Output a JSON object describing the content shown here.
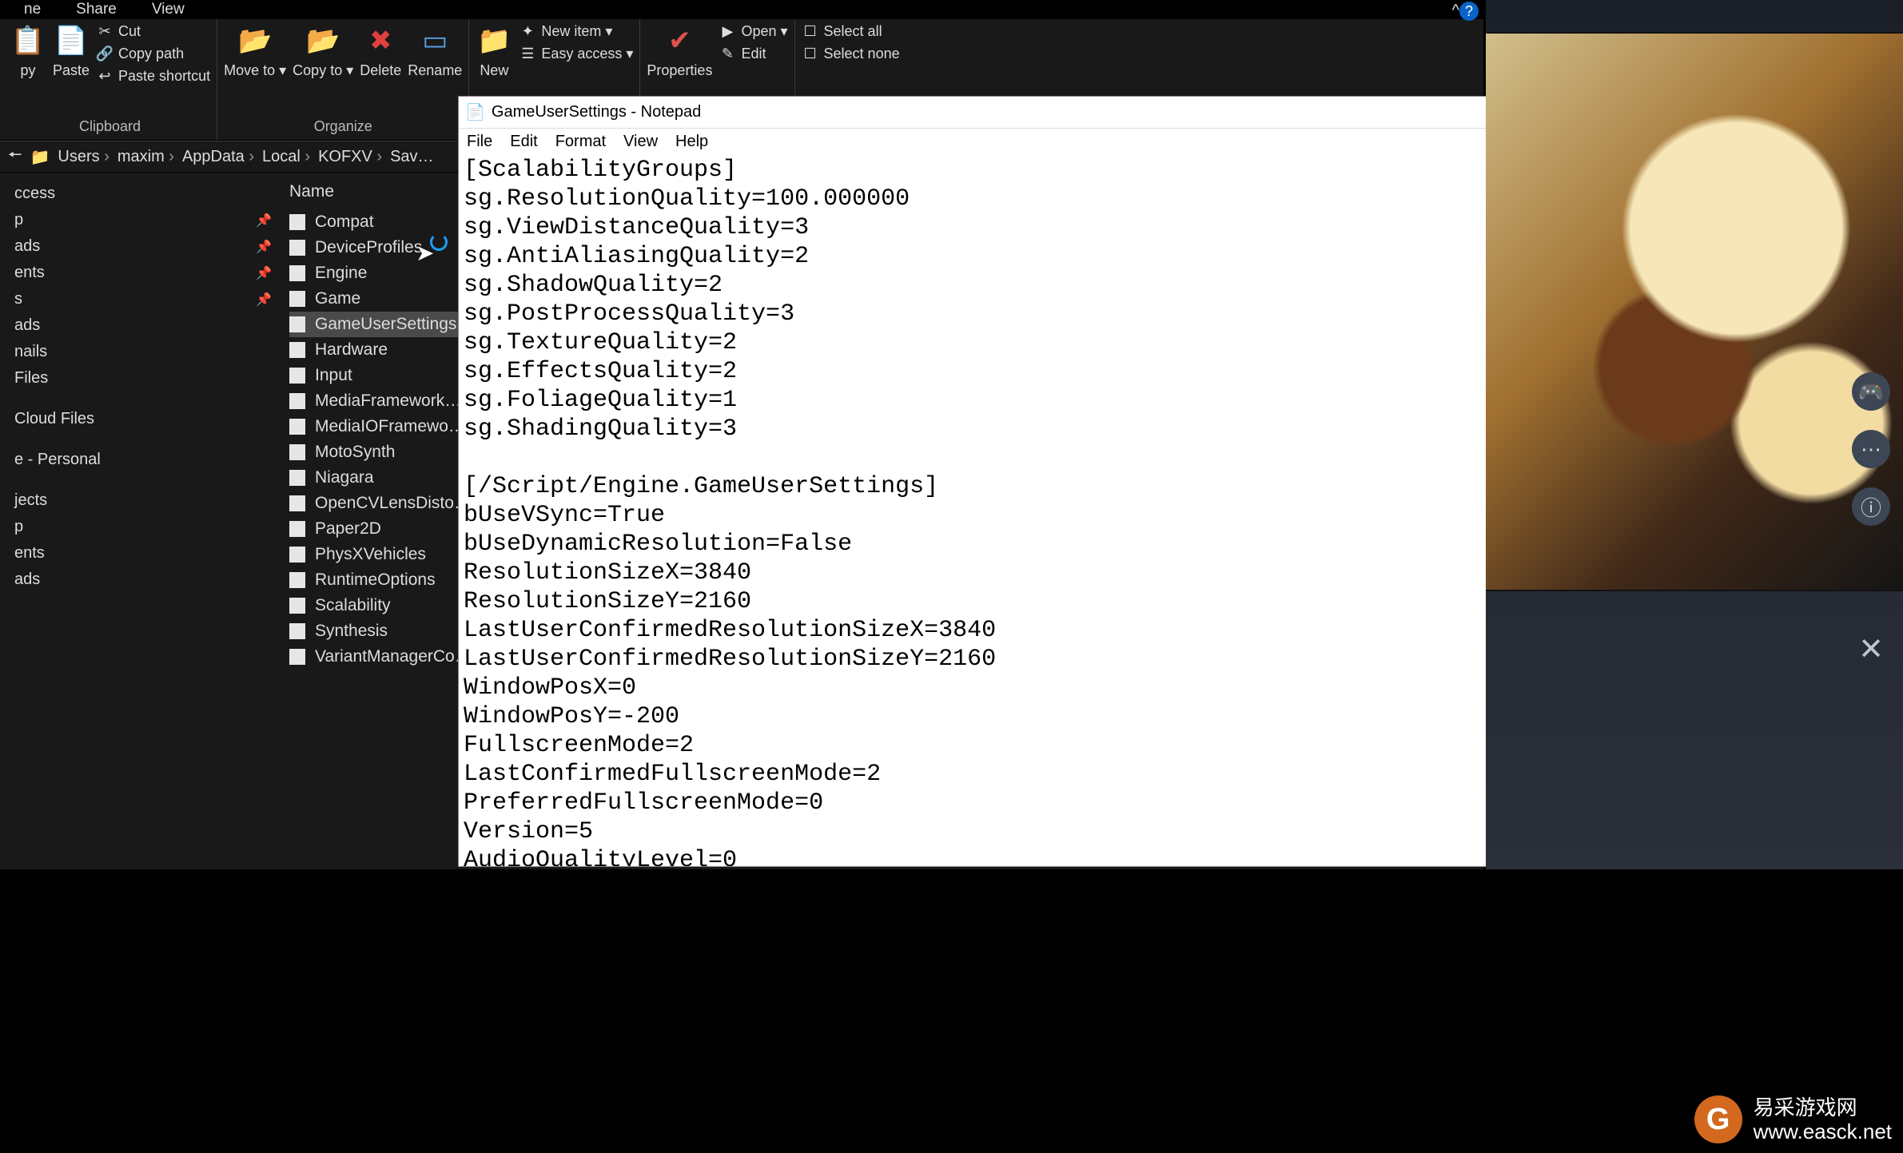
{
  "explorer": {
    "tabs": [
      "ne",
      "Share",
      "View"
    ],
    "ribbon_collapse_tip": "^",
    "ribbon": {
      "clipboard": {
        "label": "Clipboard",
        "paste": "Paste",
        "cut": "Cut",
        "copypath": "Copy path",
        "pasteshortcut": "Paste shortcut",
        "copy": "py"
      },
      "organize": {
        "label": "Organize",
        "moveto": "Move to ▾",
        "copyto": "Copy to ▾",
        "delete": "Delete",
        "rename": "Rename"
      },
      "new": {
        "label": "",
        "new": "New",
        "newitem": "New item ▾",
        "easyaccess": "Easy access ▾"
      },
      "open": {
        "label": "",
        "properties": "Properties",
        "open": "Open ▾",
        "edit": "Edit"
      },
      "select": {
        "label": "",
        "selectall": "Select all",
        "selectnone": "Select none"
      }
    },
    "breadcrumbs": [
      "Users",
      "maxim",
      "AppData",
      "Local",
      "KOFXV",
      "Sav…"
    ],
    "nav": [
      {
        "label": "ccess",
        "pin": false
      },
      {
        "label": "p",
        "pin": true
      },
      {
        "label": "ads",
        "pin": true
      },
      {
        "label": "ents",
        "pin": true
      },
      {
        "label": "s",
        "pin": true
      },
      {
        "label": "ads",
        "pin": false
      },
      {
        "label": "nails",
        "pin": false
      },
      {
        "label": "Files",
        "pin": false
      },
      {
        "sep": true
      },
      {
        "label": "Cloud Files",
        "pin": false
      },
      {
        "sep": true
      },
      {
        "label": "e - Personal",
        "pin": false
      },
      {
        "sep": true
      },
      {
        "label": "jects",
        "pin": false
      },
      {
        "label": "p",
        "pin": false
      },
      {
        "label": "ents",
        "pin": false
      },
      {
        "label": "ads",
        "pin": false
      }
    ],
    "list_header": "Name",
    "files": [
      "Compat",
      "DeviceProfiles",
      "Engine",
      "Game",
      "GameUserSettings",
      "Hardware",
      "Input",
      "MediaFramework…",
      "MediaIOFramewo…",
      "MotoSynth",
      "Niagara",
      "OpenCVLensDisto…",
      "Paper2D",
      "PhysXVehicles",
      "RuntimeOptions",
      "Scalability",
      "Synthesis",
      "VariantManagerCo…"
    ],
    "selected_index": 4
  },
  "notepad": {
    "title": "GameUserSettings - Notepad",
    "menu": [
      "File",
      "Edit",
      "Format",
      "View",
      "Help"
    ],
    "content": "[ScalabilityGroups]\nsg.ResolutionQuality=100.000000\nsg.ViewDistanceQuality=3\nsg.AntiAliasingQuality=2\nsg.ShadowQuality=2\nsg.PostProcessQuality=3\nsg.TextureQuality=2\nsg.EffectsQuality=2\nsg.FoliageQuality=1\nsg.ShadingQuality=3\n\n[/Script/Engine.GameUserSettings]\nbUseVSync=True\nbUseDynamicResolution=False\nResolutionSizeX=3840\nResolutionSizeY=2160\nLastUserConfirmedResolutionSizeX=3840\nLastUserConfirmedResolutionSizeY=2160\nWindowPosX=0\nWindowPosY=-200\nFullscreenMode=2\nLastConfirmedFullscreenMode=2\nPreferredFullscreenMode=0\nVersion=5\nAudioQualityLevel=0"
  },
  "gamepanel": {
    "side_icons": [
      "gamepad-icon",
      "ellipsis-icon",
      "info-icon"
    ],
    "close_label": "✕"
  },
  "watermark": {
    "line1": "易采游戏网",
    "line2": "www.easck.net",
    "logo": "G"
  }
}
